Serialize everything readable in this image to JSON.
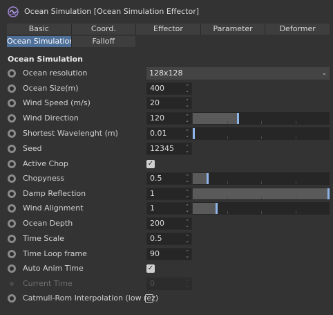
{
  "header": {
    "title": "Ocean Simulation [Ocean Simulation Effector]",
    "icon": "ocean-effector-icon"
  },
  "tabs_row1": [
    "Basic",
    "Coord.",
    "Effector",
    "Parameter",
    "Deformer"
  ],
  "tabs_row2": [
    "Ocean Simulation",
    "Falloff"
  ],
  "active_tab": "Ocean Simulation",
  "section_title": "Ocean Simulation",
  "params": {
    "ocean_resolution": {
      "label": "Ocean resolution",
      "value": "128x128"
    },
    "ocean_size": {
      "label": "Ocean Size(m)",
      "value": "400"
    },
    "wind_speed": {
      "label": "Wind Speed (m/s)",
      "value": "20"
    },
    "wind_direction": {
      "label": "Wind Direction",
      "value": "120",
      "slider_fraction": 0.33
    },
    "shortest_wavelength": {
      "label": "Shortest Wavelenght (m)",
      "value": "0.01",
      "slider_fraction": 0.0
    },
    "seed": {
      "label": "Seed",
      "value": "12345"
    },
    "active_chop": {
      "label": "Active Chop",
      "checked": true
    },
    "chopyness": {
      "label": "Chopyness",
      "value": "0.5",
      "slider_fraction": 0.1
    },
    "damp_reflection": {
      "label": "Damp Reflection",
      "value": "1",
      "slider_fraction": 1.0
    },
    "wind_alignment": {
      "label": "Wind Alignment",
      "value": "1",
      "slider_fraction": 0.17
    },
    "ocean_depth": {
      "label": "Ocean Depth",
      "value": "200"
    },
    "time_scale": {
      "label": "Time Scale",
      "value": "0.5"
    },
    "time_loop_frame": {
      "label": "Time Loop frame",
      "value": "90"
    },
    "auto_anim_time": {
      "label": "Auto Anim Time",
      "checked": true
    },
    "current_time": {
      "label": "Current Time",
      "value": "0"
    },
    "catmull_rom": {
      "label": "Catmull-Rom Interpolation (low rez)",
      "checked": false
    }
  },
  "colors": {
    "accent": "#4e6f98",
    "slider_handle": "#8fb5e8",
    "background": "#333333"
  }
}
